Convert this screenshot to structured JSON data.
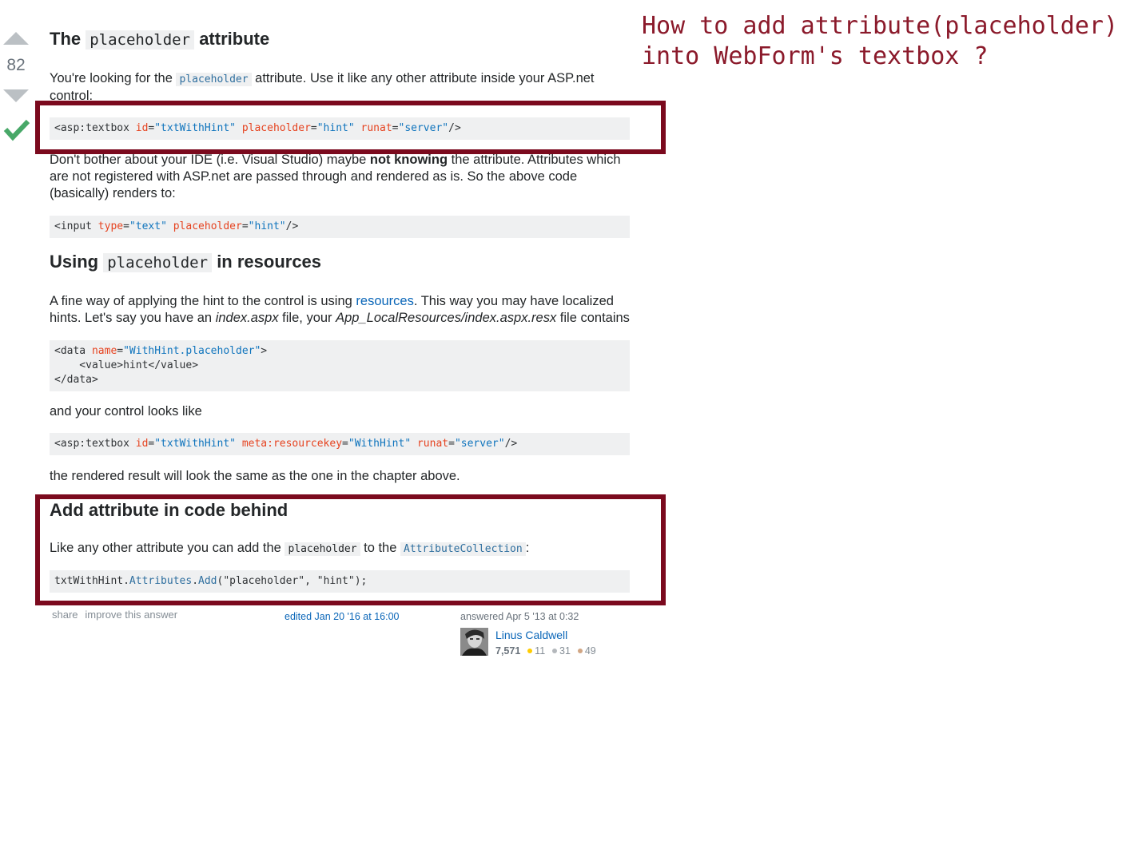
{
  "annotation": "How to add attribute(placeholder)\ninto WebForm's textbox ?",
  "vote": {
    "count": "82"
  },
  "section1": {
    "title_pre": "The ",
    "title_code": "placeholder",
    "title_post": " attribute",
    "intro_1": "You're looking for the ",
    "intro_code": "placeholder",
    "intro_2": " attribute. Use it like any other attribute inside your ASP.net control:",
    "code1": {
      "open": "<asp:textbox ",
      "a1": "id",
      "v1": "\"txtWithHint\"",
      "a2": "placeholder",
      "v2": "\"hint\"",
      "a3": "runat",
      "v3": "\"server\"",
      "close": "/>"
    },
    "note_1": "Don't bother about your IDE (i.e. Visual Studio) maybe ",
    "note_bold": "not knowing",
    "note_2": " the attribute. Attributes which are not registered with ASP.net are passed through and rendered as is. So the above code (basically) renders to:",
    "code2": {
      "open": "<input ",
      "a1": "type",
      "v1": "\"text\"",
      "a2": "placeholder",
      "v2": "\"hint\"",
      "close": "/>"
    }
  },
  "section2": {
    "title_pre": "Using ",
    "title_code": "placeholder",
    "title_post": " in resources",
    "para_1": "A fine way of applying the hint to the control is using ",
    "para_link": "resources",
    "para_2": ". This way you may have localized hints. Let's say you have an ",
    "para_em1": "index.aspx",
    "para_3": " file, your ",
    "para_em2": "App_LocalResources/index.aspx.resx",
    "para_4": " file contains",
    "code3": {
      "l1_open": "<data ",
      "l1_attr": "name",
      "l1_val": "\"WithHint.placeholder\"",
      "l1_close": ">",
      "l2_open": "    <value>",
      "l2_text": "hint",
      "l2_close": "</value>",
      "l3": "</data>"
    },
    "para_control": "and your control looks like",
    "code4": {
      "open": "<asp:textbox ",
      "a1": "id",
      "v1": "\"txtWithHint\"",
      "a2": "meta:resourcekey",
      "v2": "\"WithHint\"",
      "a3": "runat",
      "v3": "\"server\"",
      "close": "/>"
    },
    "para_result": "the rendered result will look the same as the one in the chapter above."
  },
  "section3": {
    "title": "Add attribute in code behind",
    "para_1": "Like any other attribute you can add the ",
    "para_code1": "placeholder",
    "para_2": " to the ",
    "para_code2": "AttributeCollection",
    "para_3": ":",
    "code5": {
      "obj": "txtWithHint.",
      "prop": "Attributes",
      "dot": ".",
      "method": "Add",
      "args": "(\"placeholder\", \"hint\");"
    }
  },
  "footer": {
    "share": "share",
    "improve": "improve this answer",
    "edited": "edited Jan 20 '16 at 16:00",
    "answered": "answered Apr 5 '13 at 0:32",
    "user_name": "Linus Caldwell",
    "reputation": "7,571",
    "gold": "11",
    "silver": "31",
    "bronze": "49"
  },
  "colors": {
    "highlight_border": "#7b0a1e",
    "annotation_text": "#8b1a2b",
    "accept_check": "#48a868",
    "gold": "#ffcc01",
    "silver": "#b4b8bc",
    "bronze": "#d1a684"
  }
}
